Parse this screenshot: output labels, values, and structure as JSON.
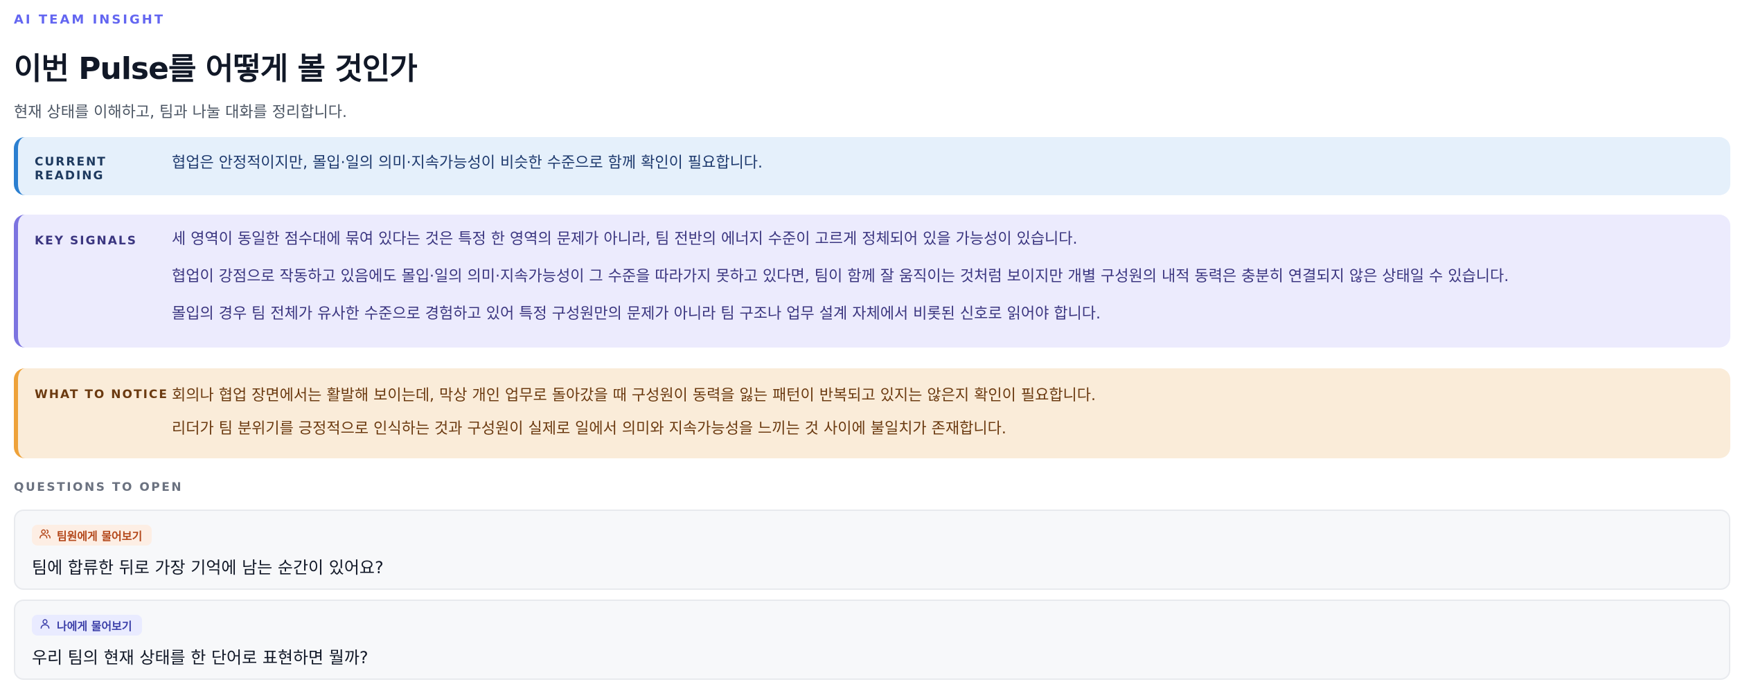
{
  "header": {
    "eyebrow": "AI TEAM INSIGHT",
    "title": "이번 Pulse를 어떻게 볼 것인가",
    "subtitle": "현재 상태를 이해하고, 팀과 나눌 대화를 정리합니다."
  },
  "current_reading": {
    "label": "CURRENT READING",
    "text": "협업은 안정적이지만, 몰입·일의 의미·지속가능성이 비슷한 수준으로 함께 확인이 필요합니다.",
    "accent": "#2b7fd0"
  },
  "key_signals": {
    "label": "KEY SIGNALS",
    "items": [
      "세 영역이 동일한 점수대에 묶여 있다는 것은 특정 한 영역의 문제가 아니라, 팀 전반의 에너지 수준이 고르게 정체되어 있을 가능성이 있습니다.",
      "협업이 강점으로 작동하고 있음에도 몰입·일의 의미·지속가능성이 그 수준을 따라가지 못하고 있다면, 팀이 함께 잘 움직이는 것처럼 보이지만 개별 구성원의 내적 동력은 충분히 연결되지 않은 상태일 수 있습니다.",
      "몰입의 경우 팀 전체가 유사한 수준으로 경험하고 있어 특정 구성원만의 문제가 아니라 팀 구조나 업무 설계 자체에서 비롯된 신호로 읽어야 합니다."
    ],
    "accent": "#7c74e0"
  },
  "what_to_notice": {
    "label": "WHAT TO NOTICE",
    "items": [
      "회의나 협업 장면에서는 활발해 보이는데, 막상 개인 업무로 돌아갔을 때 구성원이 동력을 잃는 패턴이 반복되고 있지는 않은지 확인이 필요합니다.",
      "리더가 팀 분위기를 긍정적으로 인식하는 것과 구성원이 실제로 일에서 의미와 지속가능성을 느끼는 것 사이에 불일치가 존재합니다."
    ],
    "accent": "#eea23a"
  },
  "questions": {
    "heading": "QUESTIONS TO OPEN",
    "items": [
      {
        "chip": "팀원에게 물어보기",
        "icon": "users-icon",
        "text": "팀에 합류한 뒤로 가장 기억에 남는 순간이 있어요?"
      },
      {
        "chip": "나에게 물어보기",
        "icon": "user-icon",
        "text": "우리 팀의 현재 상태를 한 단어로 표현하면 뭘까?"
      }
    ]
  }
}
